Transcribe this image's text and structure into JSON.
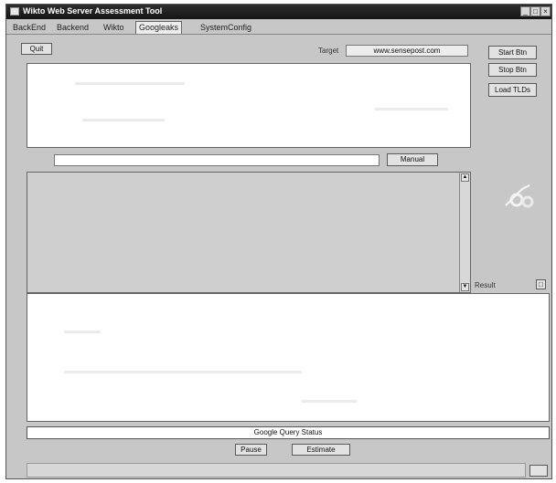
{
  "window": {
    "title": "Wikto Web Server Assessment Tool",
    "minimize_icon": "minimize-icon",
    "maximize_icon": "maximize-icon",
    "close_icon": "close-icon"
  },
  "tabs": [
    {
      "label": "BackEnd"
    },
    {
      "label": "Backend"
    },
    {
      "label": "Wikto"
    },
    {
      "label": "Googleaks",
      "active": true
    },
    {
      "label": "SystemConfig"
    }
  ],
  "toolbar": {
    "quit_label": "Quit",
    "target_label": "Target",
    "target_value": "www.sensepost.com"
  },
  "side_buttons": {
    "start_label": "Start Btn",
    "stop_label": "Stop Btn",
    "load_label": "Load TLDs"
  },
  "manual": {
    "input_value": "",
    "button_label": "Manual"
  },
  "results": {
    "label": "Result"
  },
  "status": {
    "text": "Google Query Status"
  },
  "bottom_buttons": {
    "pause_label": "Pause",
    "estimate_label": "Estimate"
  },
  "progress": {
    "fraction": 0.0
  },
  "colors": {
    "titlebar": "#1e1e1e",
    "window_bg": "#c7c7c7",
    "panel_grey": "#cfcfcf"
  }
}
